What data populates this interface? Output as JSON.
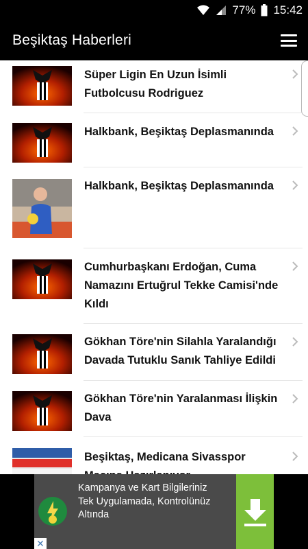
{
  "status_bar": {
    "battery": "77%",
    "time": "15:42"
  },
  "app_bar": {
    "title": "Beşiktaş Haberleri"
  },
  "news": [
    {
      "title": "Süper Ligin En Uzun İsimli Futbolcusu Rodriguez",
      "thumb": "besiktas-logo-fire"
    },
    {
      "title": "Halkbank, Beşiktaş Deplasmanında",
      "thumb": "besiktas-logo-fire"
    },
    {
      "title": "Halkbank, Beşiktaş Deplasmanında",
      "thumb": "volleyball-player-photo"
    },
    {
      "title": "Cumhurbaşkanı Erdoğan, Cuma Namazını Ertuğrul Tekke Camisi'nde Kıldı",
      "thumb": "besiktas-logo-fire"
    },
    {
      "title": "Gökhan Töre'nin Silahla Yaralandığı Davada Tutuklu Sanık Tahliye Edildi",
      "thumb": "besiktas-logo-fire"
    },
    {
      "title": "Gökhan Töre'nin Yaralanması İlişkin Dava",
      "thumb": "besiktas-logo-fire"
    },
    {
      "title": "Beşiktaş, Medicana Sivasspor Maçına Hazırlanıyor",
      "thumb": "stadium-sponsor-board"
    }
  ],
  "ad": {
    "text": "Kampanya ve Kart Bilgileriniz Tek Uygulamada, Kontrolünüz Altında",
    "close_label": "✕"
  },
  "colors": {
    "appbar": "#000000",
    "ad_background": "#4a4a4a",
    "download_button": "#7dbf3a",
    "text": "#111111"
  }
}
